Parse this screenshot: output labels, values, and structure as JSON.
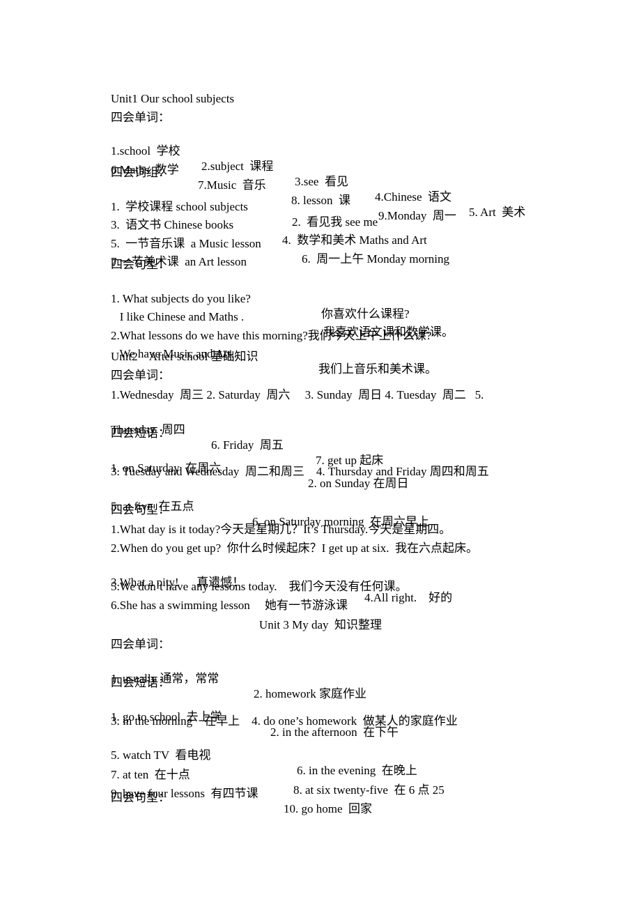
{
  "units": [
    {
      "title": "Unit1 Our school subjects",
      "words_heading": "四会单词：",
      "words_line1": [
        "1.school  学校",
        "2.subject  课程",
        "3.see  看见",
        "4.Chinese  语文",
        "5. Art  美术"
      ],
      "words_line2": [
        "6.Maths  数学",
        "7.Music  音乐",
        "8. lesson  课",
        "9.Monday  周一"
      ],
      "phrases_heading": "四会词组：",
      "phrases": [
        [
          "1.  学校课程 school subjects",
          "2.  看见我 see me"
        ],
        [
          "3.  语文书 Chinese books",
          "4.  数学和美术 Maths and Art"
        ],
        [
          "5.  一节音乐课  a Music lesson",
          "6.  周一上午 Monday morning"
        ],
        [
          "7.一节美术课  an Art lesson"
        ]
      ],
      "sentences_heading": "四会句型：",
      "sentences": [
        [
          "1. What subjects do you like?",
          "你喜欢什么课程?"
        ],
        [
          "   I like Chinese and Maths .",
          "我喜欢语文课和数学课。"
        ],
        [
          "2.What lessons do we have this morning?我们今天上午上什么课?"
        ],
        [
          "   We have Music and Art..",
          "我们上音乐和美术课。"
        ]
      ]
    },
    {
      "title": "Unit2    After school 基础知识",
      "words_heading": "四会单词：",
      "words_line1": "1.Wednesday  周三 2. Saturday  周六     3. Sunday  周日 4. Tuesday  周二   5.",
      "words_line2": [
        "Thursday  周四",
        "6. Friday  周五",
        "7. get up 起床"
      ],
      "phrases_heading": "四会短语：",
      "phrases": [
        [
          "1. on Saturday  在周六",
          "2. on Sunday 在周日"
        ],
        [
          "3. Tuesday and Wednesday  周二和周三    4. Thursday and Friday 周四和周五"
        ],
        [
          "5. at five  在五点",
          "6. on Saturday morning  在周六早上"
        ]
      ],
      "sentences_heading": "四会句型：",
      "sentences": [
        [
          "1.What day is it today?今天是星期几？It’s Thursday.今天是星期四。"
        ],
        [
          "2.When do you get up?  你什么时候起床？I get up at six.  我在六点起床。"
        ],
        [
          "3.What a pity!      真遗憾！",
          "4.All right.    好的"
        ],
        [
          "5.We don’t have any lessons today.    我们今天没有任何课。"
        ],
        [
          "6.She has a swimming lesson     她有一节游泳课"
        ]
      ]
    },
    {
      "title": "Unit 3 My day  知识整理",
      "words_heading": "四会单词：",
      "words": [
        "1. usually 通常，常常",
        "2. homework 家庭作业"
      ],
      "phrases_heading": "四会短语：",
      "phrases": [
        [
          "1. go to school  去上学",
          "2. in the afternoon  在下午"
        ],
        [
          "3. in the morning    在早上    4. do one’s homework  做某人的家庭作业"
        ],
        [
          "5. watch TV  看电视",
          "6. in the evening  在晚上"
        ],
        [
          "7. at ten  在十点",
          "8. at six twenty-five  在 6 点 25"
        ],
        [
          "9. have four lessons  有四节课",
          "10. go home  回家"
        ]
      ],
      "sentences_heading": "四会句型："
    }
  ]
}
